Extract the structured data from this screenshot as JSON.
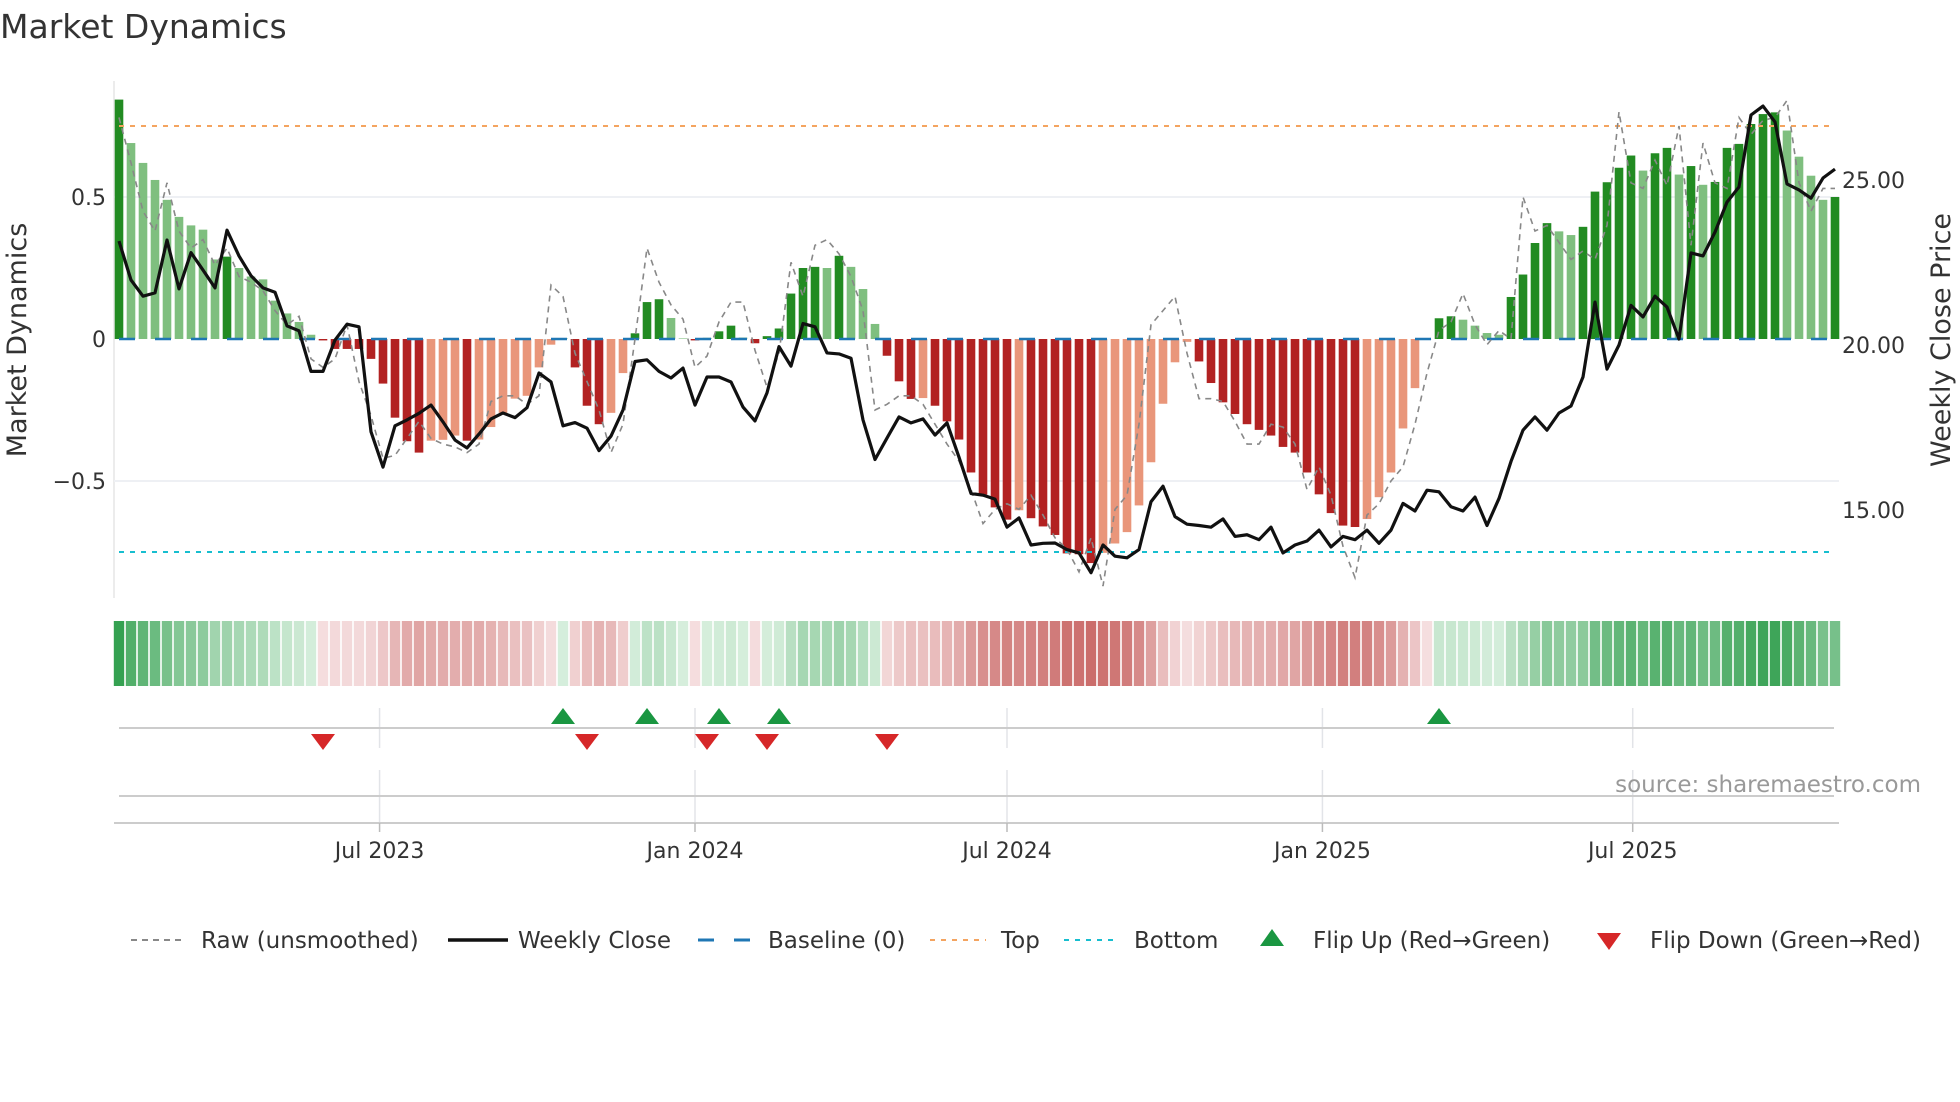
{
  "chart_data": {
    "type": "bar",
    "title": "Market Dynamics",
    "ylabel_left": "Market Dynamics",
    "ylabel_right": "Weekly Close Price",
    "ylim_left": [
      -0.92,
      0.92
    ],
    "ylim_right": [
      12.5,
      27.5
    ],
    "left_ticks": [
      {
        "v": 0.5,
        "label": "0.5"
      },
      {
        "v": 0,
        "label": "0"
      },
      {
        "v": -0.5,
        "label": "−0.5"
      }
    ],
    "right_ticks": [
      {
        "v": 25,
        "label": "25.00"
      },
      {
        "v": 20,
        "label": "20.00"
      },
      {
        "v": 15,
        "label": "15.00"
      }
    ],
    "x_start": "2023-01-30",
    "x_step_days": 7,
    "x_ticks": [
      {
        "date": "2023-07-01",
        "label": "Jul 2023"
      },
      {
        "date": "2024-01-01",
        "label": "Jan 2024"
      },
      {
        "date": "2024-07-01",
        "label": "Jul 2024"
      },
      {
        "date": "2025-01-01",
        "label": "Jan 2025"
      },
      {
        "date": "2025-07-01",
        "label": "Jul 2025"
      }
    ],
    "top_level": 0.75,
    "bottom_level": -0.75,
    "baseline": 0,
    "series": [
      {
        "name": "Market Dynamics (smoothed)",
        "values": [
          0.843,
          0.69,
          0.62,
          0.56,
          0.49,
          0.43,
          0.4,
          0.385,
          0.28,
          0.29,
          0.25,
          0.22,
          0.21,
          0.135,
          0.09,
          0.06,
          0.015,
          -0.005,
          -0.035,
          -0.035,
          -0.035,
          -0.07,
          -0.157,
          -0.277,
          -0.36,
          -0.4,
          -0.358,
          -0.355,
          -0.34,
          -0.358,
          -0.354,
          -0.31,
          -0.26,
          -0.21,
          -0.2,
          -0.1,
          -0.02,
          0.003,
          -0.1,
          -0.235,
          -0.3,
          -0.26,
          -0.12,
          0.02,
          0.13,
          0.14,
          0.074,
          0.002,
          -0.005,
          0.004,
          0.027,
          0.047,
          0.005,
          -0.015,
          0.01,
          0.037,
          0.16,
          0.25,
          0.254,
          0.25,
          0.293,
          0.254,
          0.176,
          0.053,
          -0.059,
          -0.149,
          -0.211,
          -0.208,
          -0.235,
          -0.29,
          -0.354,
          -0.47,
          -0.548,
          -0.593,
          -0.636,
          -0.603,
          -0.631,
          -0.66,
          -0.69,
          -0.755,
          -0.758,
          -0.789,
          -0.753,
          -0.72,
          -0.68,
          -0.586,
          -0.434,
          -0.228,
          -0.082,
          -0.01,
          -0.079,
          -0.155,
          -0.223,
          -0.264,
          -0.3,
          -0.32,
          -0.34,
          -0.38,
          -0.4,
          -0.47,
          -0.547,
          -0.613,
          -0.657,
          -0.662,
          -0.634,
          -0.557,
          -0.47,
          -0.315,
          -0.173,
          -0.001,
          0.073,
          0.08,
          0.068,
          0.047,
          0.021,
          0.015,
          0.148,
          0.227,
          0.338,
          0.408,
          0.379,
          0.366,
          0.395,
          0.519,
          0.552,
          0.603,
          0.646,
          0.593,
          0.654,
          0.673,
          0.579,
          0.609,
          0.543,
          0.553,
          0.673,
          0.687,
          0.757,
          0.792,
          0.798,
          0.734,
          0.642,
          0.575,
          0.49,
          0.5
        ]
      },
      {
        "name": "Raw (unsmoothed)",
        "values": [
          0.78,
          0.62,
          0.45,
          0.38,
          0.55,
          0.38,
          0.32,
          0.35,
          0.26,
          0.32,
          0.22,
          0.2,
          0.17,
          0.1,
          0.05,
          0.08,
          -0.07,
          -0.1,
          -0.07,
          0.05,
          -0.15,
          -0.27,
          -0.42,
          -0.41,
          -0.35,
          -0.29,
          -0.35,
          -0.37,
          -0.38,
          -0.4,
          -0.37,
          -0.22,
          -0.2,
          -0.2,
          -0.23,
          -0.2,
          0.19,
          0.15,
          -0.05,
          -0.15,
          -0.25,
          -0.4,
          -0.3,
          0.0,
          0.32,
          0.2,
          0.12,
          0.07,
          -0.1,
          -0.06,
          0.06,
          0.13,
          0.13,
          -0.04,
          -0.17,
          -0.05,
          0.27,
          0.15,
          0.33,
          0.35,
          0.3,
          0.22,
          0.1,
          -0.25,
          -0.23,
          -0.2,
          -0.2,
          -0.23,
          -0.3,
          -0.37,
          -0.43,
          -0.53,
          -0.65,
          -0.6,
          -0.58,
          -0.6,
          -0.55,
          -0.62,
          -0.7,
          -0.74,
          -0.82,
          -0.7,
          -0.87,
          -0.6,
          -0.55,
          -0.3,
          0.05,
          0.1,
          0.15,
          -0.05,
          -0.21,
          -0.21,
          -0.22,
          -0.29,
          -0.37,
          -0.37,
          -0.3,
          -0.31,
          -0.37,
          -0.53,
          -0.45,
          -0.55,
          -0.73,
          -0.84,
          -0.62,
          -0.58,
          -0.5,
          -0.45,
          -0.3,
          -0.12,
          0.03,
          0.06,
          0.16,
          0.05,
          -0.02,
          0.03,
          0.0,
          0.5,
          0.38,
          0.4,
          0.34,
          0.28,
          0.31,
          0.28,
          0.4,
          0.8,
          0.55,
          0.53,
          0.63,
          0.54,
          0.75,
          0.33,
          0.69,
          0.55,
          0.53,
          0.78,
          0.72,
          0.77,
          0.78,
          0.84,
          0.55,
          0.45,
          0.53,
          0.53
        ]
      },
      {
        "name": "Weekly Close",
        "axis": "right",
        "values": [
          23.15,
          21.97,
          21.48,
          21.58,
          23.18,
          21.7,
          22.8,
          22.27,
          21.73,
          23.48,
          22.7,
          22.1,
          21.73,
          21.6,
          20.58,
          20.43,
          19.2,
          19.2,
          20.15,
          20.63,
          20.55,
          17.37,
          16.3,
          17.55,
          17.73,
          17.93,
          18.18,
          17.67,
          17.12,
          16.88,
          17.3,
          17.76,
          17.94,
          17.8,
          18.1,
          19.15,
          18.88,
          17.55,
          17.65,
          17.48,
          16.8,
          17.24,
          18.03,
          19.5,
          19.55,
          19.2,
          19.0,
          19.3,
          18.18,
          19.03,
          19.03,
          18.88,
          18.12,
          17.7,
          18.55,
          19.95,
          19.36,
          20.65,
          20.55,
          19.76,
          19.73,
          19.6,
          17.73,
          16.53,
          17.18,
          17.82,
          17.64,
          17.76,
          17.27,
          17.64,
          16.6,
          15.5,
          15.45,
          15.33,
          14.48,
          14.76,
          13.94,
          13.99,
          14.0,
          13.8,
          13.7,
          13.1,
          13.94,
          13.6,
          13.55,
          13.8,
          15.25,
          15.72,
          14.8,
          14.57,
          14.53,
          14.48,
          14.73,
          14.2,
          14.25,
          14.1,
          14.48,
          13.7,
          13.94,
          14.06,
          14.39,
          13.88,
          14.2,
          14.1,
          14.39,
          13.99,
          14.39,
          15.2,
          14.97,
          15.6,
          15.55,
          15.1,
          14.97,
          15.39,
          14.53,
          15.35,
          16.47,
          17.42,
          17.82,
          17.42,
          17.94,
          18.15,
          19.03,
          21.3,
          19.27,
          20.0,
          21.2,
          20.85,
          21.48,
          21.15,
          20.18,
          22.79,
          22.7,
          23.42,
          24.33,
          24.79,
          26.97,
          27.24,
          26.76,
          24.88,
          24.7,
          24.45,
          25.06,
          25.33
        ]
      }
    ],
    "flip_up_weeks": [
      37,
      44,
      50,
      55,
      110
    ],
    "flip_down_weeks": [
      17,
      39,
      49,
      54,
      64
    ],
    "legend": {
      "placement": "bottom",
      "raw": "Raw (unsmoothed)",
      "close": "Weekly Close",
      "baseline": "Baseline (0)",
      "top": "Top",
      "bottom": "Bottom",
      "flip_up": "Flip Up (Red→Green)",
      "flip_down": "Flip Down (Green→Red)"
    },
    "source": "source: sharemaestro.com"
  },
  "colors": {
    "green_dark": "#228b22",
    "green_light": "#7fbf7f",
    "red_dark": "#b22222",
    "red_light": "#e9967a",
    "close": "#111111",
    "raw": "#888888",
    "baseline": "#1f77b4",
    "top": "#f4a460",
    "bottom": "#17becf",
    "flip_up": "#1a9641",
    "flip_down": "#d62728"
  }
}
